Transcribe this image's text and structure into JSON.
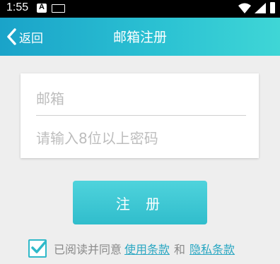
{
  "statusbar": {
    "time": "1:55"
  },
  "appbar": {
    "back_label": "返回",
    "title": "邮箱注册"
  },
  "form": {
    "email_placeholder": "邮箱",
    "password_placeholder": "请输入8位以上密码"
  },
  "register_button": "注 册",
  "agreement": {
    "checked": true,
    "prefix": "已阅读并同意",
    "terms_link": "使用条款",
    "conjunction": "和",
    "privacy_link": "隐私条款"
  },
  "colors": {
    "accent": "#2cc3d3",
    "link": "#2aa7c2",
    "background": "#eeeeee"
  }
}
